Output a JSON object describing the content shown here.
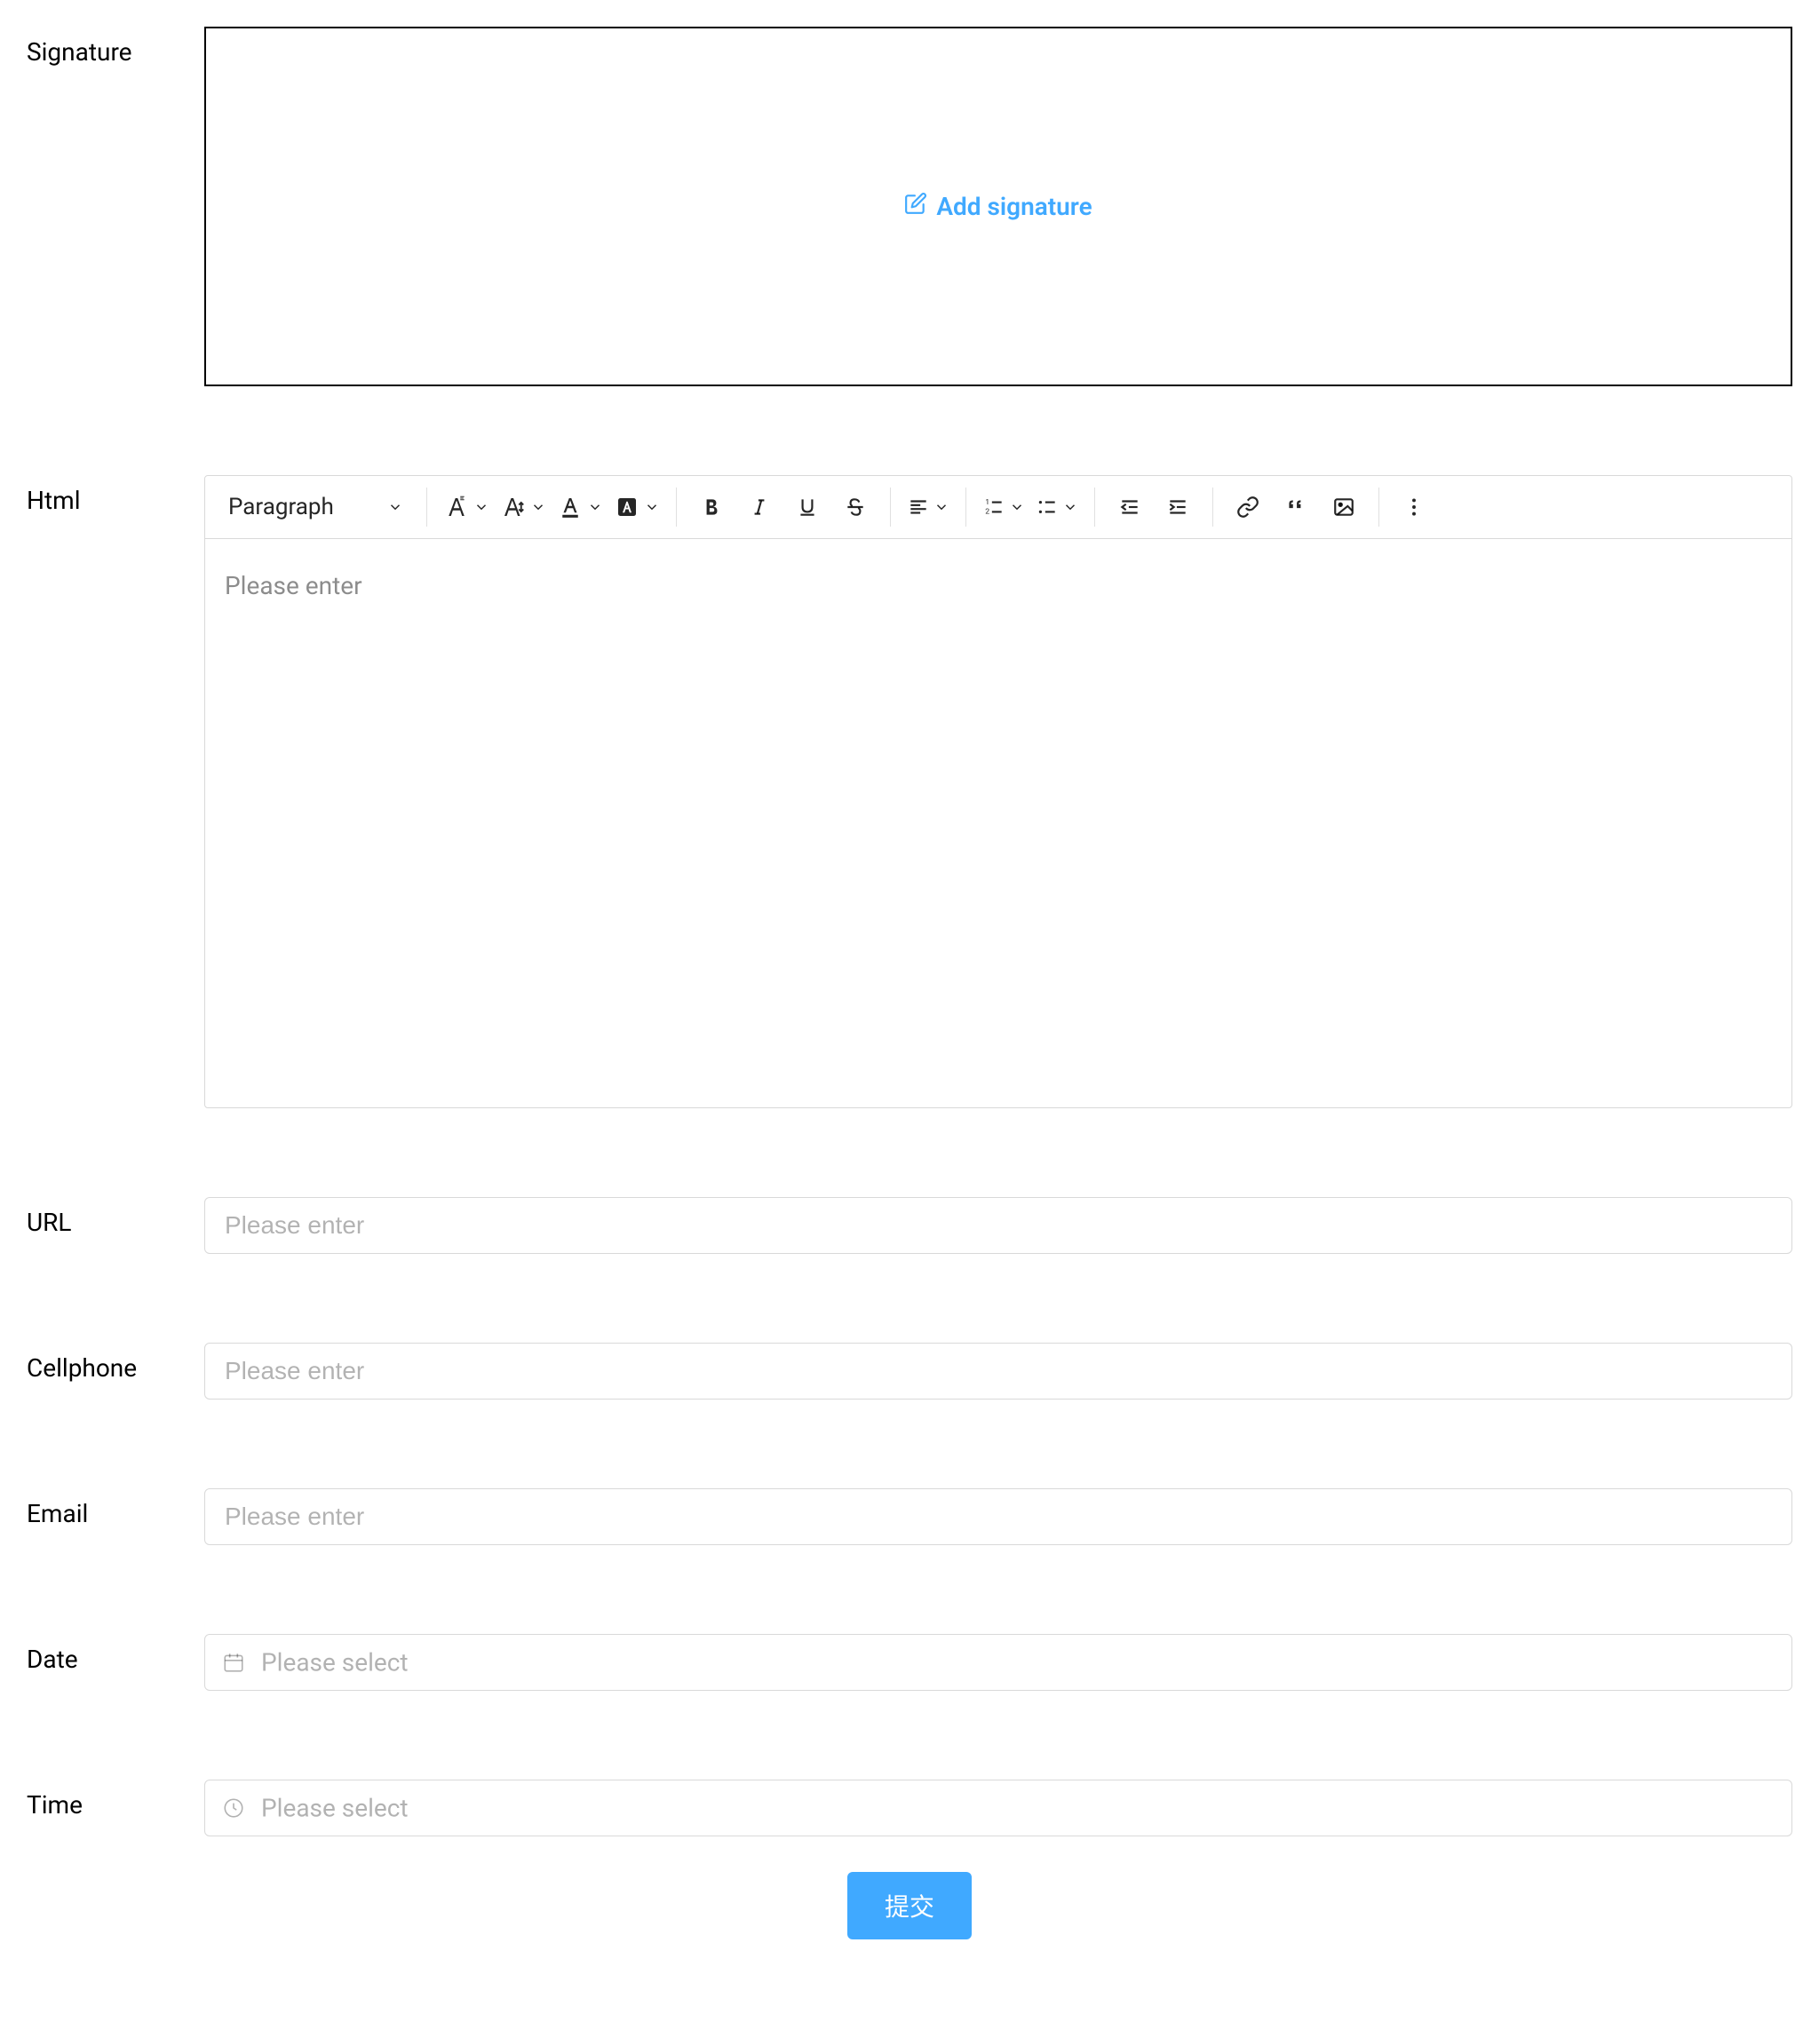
{
  "labels": {
    "signature": "Signature",
    "html": "Html",
    "url": "URL",
    "cellphone": "Cellphone",
    "email": "Email",
    "date": "Date",
    "time": "Time"
  },
  "signature": {
    "add_label": "Add signature"
  },
  "editor": {
    "paragraph": "Paragraph",
    "placeholder": "Please enter"
  },
  "inputs": {
    "url_placeholder": "Please enter",
    "cellphone_placeholder": "Please enter",
    "email_placeholder": "Please enter",
    "date_placeholder": "Please select",
    "time_placeholder": "Please select"
  },
  "submit": {
    "label": "提交"
  }
}
